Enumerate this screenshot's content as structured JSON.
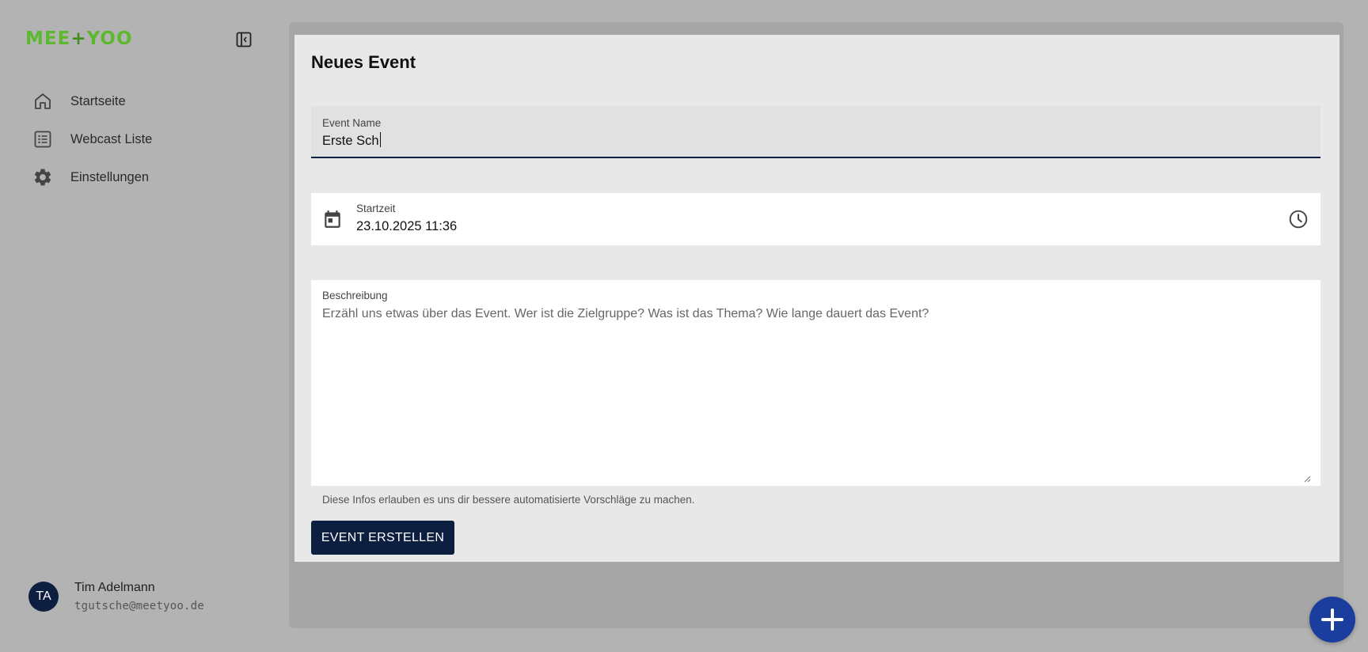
{
  "sidebar": {
    "logo": {
      "left": "MEE",
      "plus": "+",
      "right": "YOO"
    },
    "items": [
      {
        "label": "Startseite",
        "icon": "home-icon"
      },
      {
        "label": "Webcast Liste",
        "icon": "list-icon"
      },
      {
        "label": "Einstellungen",
        "icon": "gear-icon"
      }
    ],
    "user": {
      "initials": "TA",
      "name": "Tim Adelmann",
      "email": "tgutsche@meetyoo.de"
    }
  },
  "form": {
    "title": "Neues Event",
    "event_name": {
      "label": "Event Name",
      "value": "Erste Sch"
    },
    "start_time": {
      "label": "Startzeit",
      "value": "23.10.2025 11:36"
    },
    "description": {
      "label": "Beschreibung",
      "placeholder": "Erzähl uns etwas über das Event. Wer ist die Zielgruppe? Was ist das Thema? Wie lange dauert das Event?",
      "helper": "Diese Infos erlauben es uns dir bessere automatisierte Vorschläge zu machen."
    },
    "submit_label": "EVENT ERSTELLEN"
  },
  "colors": {
    "brand_green": "#5cb82e",
    "primary_navy": "#0d1f40",
    "fab_blue": "#1b3e9e"
  }
}
